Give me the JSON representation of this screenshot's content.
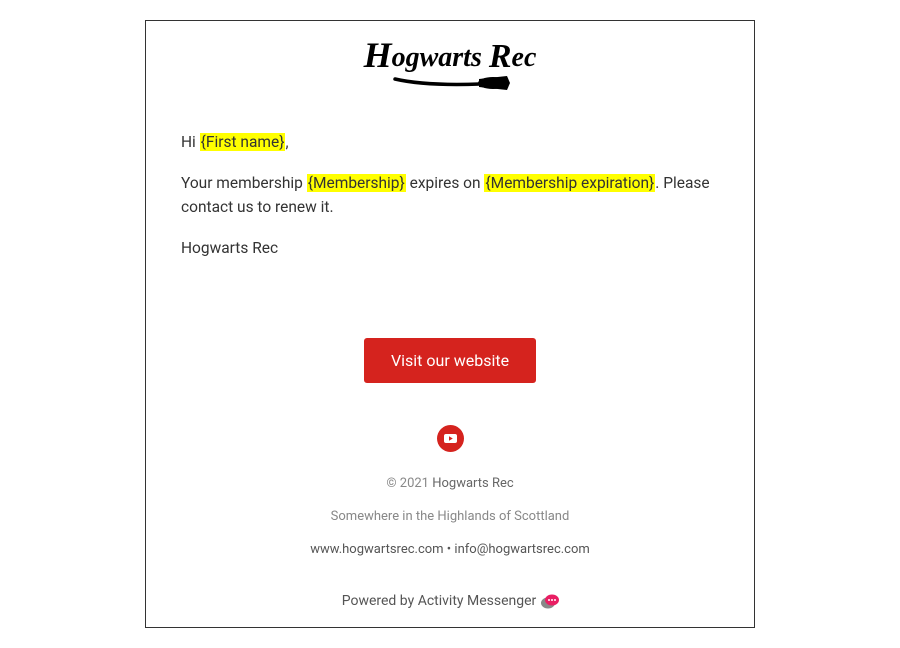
{
  "logo": {
    "brand": "Hogwarts Rec"
  },
  "greeting": {
    "prefix": "Hi ",
    "placeholder": "{First name}",
    "suffix": ","
  },
  "body": {
    "line1_part1": "Your membership ",
    "line1_placeholder1": "{Membership}",
    "line1_part2": " expires on ",
    "line1_placeholder2": "{Membership expiration}",
    "line1_part3": ".  Please contact us to renew it."
  },
  "signature": "Hogwarts Rec",
  "cta": {
    "label": "Visit our website"
  },
  "footer": {
    "copyright_prefix": "© 2021 ",
    "company": "Hogwarts Rec",
    "address": "Somewhere in the Highlands of Scottland",
    "website": "www.hogwartsrec.com",
    "separator": " • ",
    "email": "info@hogwartsrec.com"
  },
  "powered": {
    "prefix": "Powered by ",
    "name": "Activity Messenger"
  }
}
